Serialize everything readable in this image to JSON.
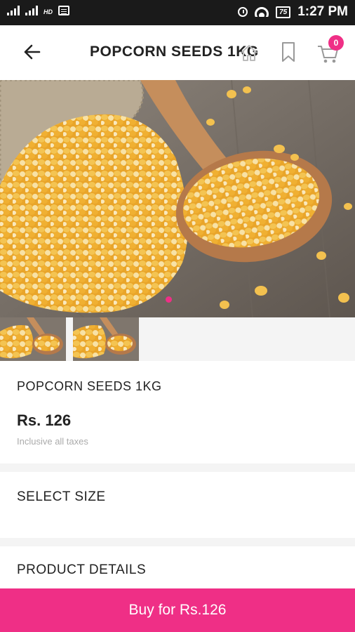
{
  "status_bar": {
    "carrier_labels": [
      "",
      "HD"
    ],
    "battery": "75",
    "time": "1:27 PM"
  },
  "header": {
    "title": "POPCORN SEEDS 1KG",
    "cart_count": "0"
  },
  "gallery": {
    "images": [
      "popcorn-kernels-in-sack-and-spoon",
      "popcorn-kernels-thumb-1",
      "popcorn-kernels-thumb-2"
    ],
    "active_index": 0
  },
  "product": {
    "name": "POPCORN SEEDS 1KG",
    "price": "Rs. 126",
    "tax_note": "Inclusive all taxes"
  },
  "sections": {
    "select_size": "SELECT SIZE",
    "product_details": "PRODUCT DETAILS"
  },
  "buy_button": {
    "label": "Buy for Rs.126"
  },
  "colors": {
    "accent": "#ef2f86",
    "status_bar": "#1a1a1a"
  }
}
